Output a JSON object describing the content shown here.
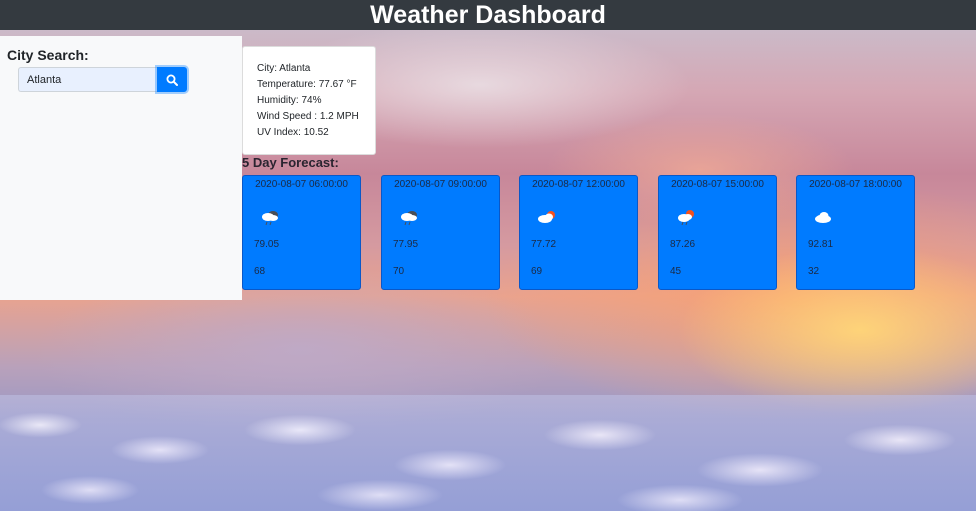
{
  "header": {
    "title": "Weather Dashboard"
  },
  "search": {
    "title": "City Search:",
    "input_value": "Atlanta",
    "button_icon": "search-icon",
    "button_color": "#007bff"
  },
  "current": {
    "city_line": "City: Atlanta",
    "temperature_line": "Temperature: 77.67 °F",
    "humidity_line": "Humidity: 74%",
    "wind_line": "Wind Speed : 1.2 MPH",
    "uv_line": "UV Index: 10.52"
  },
  "forecast": {
    "title": "5 Day Forecast:",
    "card_color": "#007bff",
    "days": [
      {
        "datetime": "2020-08-07 06:00:00",
        "icon": "rain-cloud-icon",
        "temp": "79.05",
        "humidity": "68"
      },
      {
        "datetime": "2020-08-07 09:00:00",
        "icon": "rain-cloud-icon",
        "temp": "77.95",
        "humidity": "70"
      },
      {
        "datetime": "2020-08-07 12:00:00",
        "icon": "partly-cloudy-icon",
        "temp": "77.72",
        "humidity": "69"
      },
      {
        "datetime": "2020-08-07 15:00:00",
        "icon": "sun-rain-cloud-icon",
        "temp": "87.26",
        "humidity": "45"
      },
      {
        "datetime": "2020-08-07 18:00:00",
        "icon": "cloud-icon",
        "temp": "92.81",
        "humidity": "32"
      }
    ]
  }
}
